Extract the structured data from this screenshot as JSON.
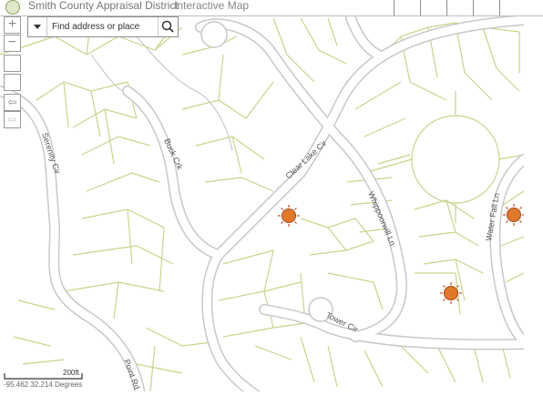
{
  "header": {
    "title": "Smith County Appraisal District",
    "subtitle": "Interactive Map"
  },
  "search": {
    "placeholder": "Find address or place"
  },
  "controls": {
    "zoom_in": "+",
    "zoom_out": "−",
    "back": "⇦",
    "forward": "⇨"
  },
  "roads": {
    "serenity": "Serenity Cir",
    "buck": "Buck Crk",
    "clear_lake": "Clear Lake Cir",
    "whippoorwill": "Whippoorwill Ln",
    "water_fall": "Water Fall Ln",
    "tower": "Tower Cir",
    "point": "Point Rd"
  },
  "scale": {
    "label": "200ft"
  },
  "coordinates": "-95.462 32.214 Degrees",
  "colors": {
    "parcel_line": "#c5d68a",
    "road_fill": "#ffffff",
    "road_casing": "#c8c8c8",
    "marker": "#e07a2a"
  },
  "icons": [
    "search-icon",
    "dropdown-icon",
    "sun-marker-icon",
    "logo-icon"
  ]
}
